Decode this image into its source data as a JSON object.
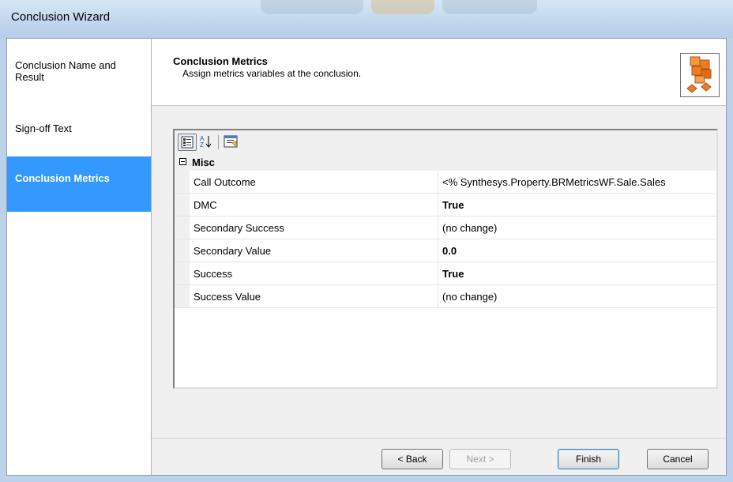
{
  "window": {
    "title": "Conclusion Wizard"
  },
  "sidebar": {
    "items": [
      {
        "label": "Conclusion Name and Result",
        "active": false
      },
      {
        "label": "Sign-off Text",
        "active": false
      },
      {
        "label": "Conclusion Metrics",
        "active": true
      }
    ]
  },
  "header": {
    "title": "Conclusion Metrics",
    "subtitle": "Assign metrics variables at the conclusion.",
    "logo_icon": "orange-cubes-icon"
  },
  "toolbar": {
    "icons": [
      "categorized-icon",
      "alphabetical-sort-icon",
      "property-pages-icon"
    ]
  },
  "grid": {
    "category": "Misc",
    "rows": [
      {
        "name": "Call Outcome",
        "value": "<% Synthesys.Property.BRMetricsWF.Sale.Sales",
        "bold": false
      },
      {
        "name": "DMC",
        "value": "True",
        "bold": true
      },
      {
        "name": "Secondary Success",
        "value": "(no change)",
        "bold": false
      },
      {
        "name": "Secondary Value",
        "value": "0.0",
        "bold": true
      },
      {
        "name": "Success",
        "value": "True",
        "bold": true
      },
      {
        "name": "Success Value",
        "value": "(no change)",
        "bold": false
      }
    ]
  },
  "buttons": {
    "back": "< Back",
    "next": "Next >",
    "finish": "Finish",
    "cancel": "Cancel"
  },
  "colors": {
    "selection": "#3399ff",
    "accent_orange": "#f07d1e"
  }
}
